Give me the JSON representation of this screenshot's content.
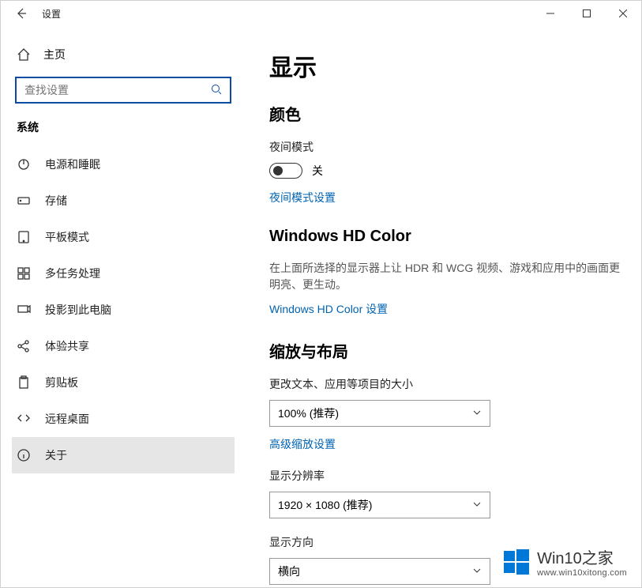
{
  "titlebar": {
    "title": "设置"
  },
  "sidebar": {
    "home_label": "主页",
    "search_placeholder": "查找设置",
    "section_label": "系统",
    "items": [
      {
        "label": "电源和睡眠"
      },
      {
        "label": "存储"
      },
      {
        "label": "平板模式"
      },
      {
        "label": "多任务处理"
      },
      {
        "label": "投影到此电脑"
      },
      {
        "label": "体验共享"
      },
      {
        "label": "剪贴板"
      },
      {
        "label": "远程桌面"
      },
      {
        "label": "关于"
      }
    ]
  },
  "content": {
    "page_title": "显示",
    "color": {
      "heading": "颜色",
      "night_mode_label": "夜间模式",
      "night_mode_state": "关",
      "night_mode_link": "夜间模式设置"
    },
    "hdcolor": {
      "heading": "Windows HD Color",
      "desc": "在上面所选择的显示器上让 HDR 和 WCG 视频、游戏和应用中的画面更明亮、更生动。",
      "link": "Windows HD Color 设置"
    },
    "scale": {
      "heading": "缩放与布局",
      "text_size_label": "更改文本、应用等项目的大小",
      "text_size_value": "100% (推荐)",
      "advanced_link": "高级缩放设置",
      "resolution_label": "显示分辨率",
      "resolution_value": "1920 × 1080 (推荐)",
      "orientation_label": "显示方向",
      "orientation_value": "横向"
    }
  },
  "watermark": {
    "brand": "Win10",
    "suffix": "之家",
    "url": "www.win10xitong.com"
  }
}
